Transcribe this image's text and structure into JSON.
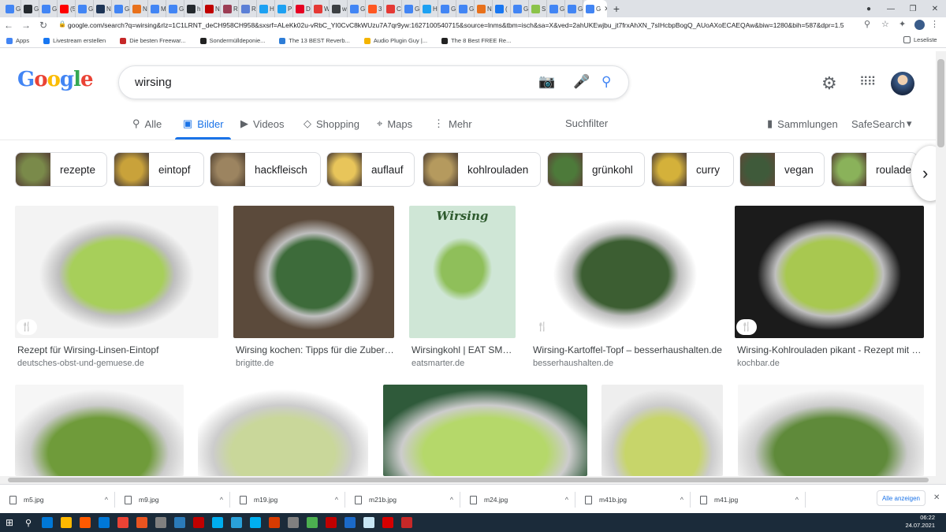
{
  "browser": {
    "tabs": [
      {
        "label": "G",
        "color": "#4285f4"
      },
      {
        "label": "G",
        "color": "#24292e"
      },
      {
        "label": "G",
        "color": "#4285f4"
      },
      {
        "label": "(5",
        "color": "#ff0000"
      },
      {
        "label": "G",
        "color": "#4285f4"
      },
      {
        "label": "N",
        "color": "#1d3557"
      },
      {
        "label": "G",
        "color": "#4285f4"
      },
      {
        "label": "N",
        "color": "#e8711c"
      },
      {
        "label": "M",
        "color": "#4285f4"
      },
      {
        "label": "G",
        "color": "#4285f4"
      },
      {
        "label": "h",
        "color": "#24292e"
      },
      {
        "label": "N",
        "color": "#c00000"
      },
      {
        "label": "R",
        "color": "#9c3d54"
      },
      {
        "label": "R",
        "color": "#5b7fd6"
      },
      {
        "label": "H",
        "color": "#1da1f2"
      },
      {
        "label": "P",
        "color": "#1da1f2"
      },
      {
        "label": "D",
        "color": "#e60023"
      },
      {
        "label": "W",
        "color": "#e53935"
      },
      {
        "label": "w",
        "color": "#3c4043"
      },
      {
        "label": "G",
        "color": "#4285f4"
      },
      {
        "label": "3",
        "color": "#ff5722"
      },
      {
        "label": "C",
        "color": "#e53935"
      },
      {
        "label": "G",
        "color": "#4285f4"
      },
      {
        "label": "H",
        "color": "#1da1f2"
      },
      {
        "label": "G",
        "color": "#4285f4"
      },
      {
        "label": "G",
        "color": "#4285f4"
      },
      {
        "label": "N",
        "color": "#e8711c"
      },
      {
        "label": "(",
        "color": "#1877f2"
      },
      {
        "label": "G",
        "color": "#4285f4"
      },
      {
        "label": "S",
        "color": "#8bc34a"
      },
      {
        "label": "G",
        "color": "#4285f4"
      },
      {
        "label": "G",
        "color": "#4285f4"
      },
      {
        "label": "G",
        "color": "#4285f4"
      }
    ],
    "active_tab_label": "G",
    "new_tab": "+",
    "url": "google.com/search?q=wirsing&rlz=1C1LRNT_deCH958CH958&sxsrf=ALeKk02u-vRbC_YI0CvC8kWUzu7A7qr9yw:1627100540715&source=lnms&tbm=isch&sa=X&ved=2ahUKEwjbu_jt7frxAhXN_7sIHcbpBogQ_AUoAXoECAEQAw&biw=1280&bih=587&dpr=1.5",
    "bookmarks": [
      {
        "label": "Apps",
        "color": "#4285f4"
      },
      {
        "label": "Livestream erstellen",
        "color": "#1877f2"
      },
      {
        "label": "Die besten Freewar...",
        "color": "#c62828"
      },
      {
        "label": "Sondermülldeponie...",
        "color": "#222222"
      },
      {
        "label": "The 13 BEST Reverb...",
        "color": "#2e7dd7"
      },
      {
        "label": "Audio Plugin Guy |...",
        "color": "#f4b400"
      },
      {
        "label": "The 8 Best FREE Re...",
        "color": "#222222"
      }
    ],
    "reading_list": "Leseliste"
  },
  "google": {
    "logo_letters": [
      {
        "char": "G",
        "color": "#4285f4"
      },
      {
        "char": "o",
        "color": "#ea4335"
      },
      {
        "char": "o",
        "color": "#fbbc05"
      },
      {
        "char": "g",
        "color": "#4285f4"
      },
      {
        "char": "l",
        "color": "#34a853"
      },
      {
        "char": "e",
        "color": "#ea4335"
      }
    ],
    "query": "wirsing",
    "nav": {
      "all": "Alle",
      "images": "Bilder",
      "videos": "Videos",
      "shopping": "Shopping",
      "maps": "Maps",
      "more": "Mehr",
      "filter": "Suchfilter",
      "collections": "Sammlungen",
      "safesearch": "SafeSearch"
    },
    "chips": [
      {
        "label": "rezepte",
        "color": "#7a8a4a"
      },
      {
        "label": "eintopf",
        "color": "#c9a23a"
      },
      {
        "label": "hackfleisch",
        "color": "#9c8460"
      },
      {
        "label": "auflauf",
        "color": "#e8c55a"
      },
      {
        "label": "kohlrouladen",
        "color": "#b59a5e"
      },
      {
        "label": "grünkohl",
        "color": "#4d7a3a"
      },
      {
        "label": "curry",
        "color": "#d4b13a"
      },
      {
        "label": "vegan",
        "color": "#3f5a3a"
      },
      {
        "label": "roulade",
        "color": "#8ab25a"
      }
    ],
    "results_row1": [
      {
        "title": "Rezept für Wirsing-Linsen-Eintopf",
        "source": "deutsches-obst-und-gemuese.de",
        "recipe": true,
        "bg": "#f3f3f3",
        "leaf": "#a7cf5a"
      },
      {
        "title": "Wirsing kochen: Tipps für die Zubereitung",
        "source": "brigitte.de",
        "recipe": false,
        "bg": "#5b4a3b",
        "leaf": "#3d6b3a"
      },
      {
        "title": "Wirsingkohl | EAT SMARTER",
        "source": "eatsmarter.de",
        "recipe": false,
        "bg": "#cfe6d6",
        "leaf": "#8fbf5a",
        "infographic": "Wirsing"
      },
      {
        "title": "Wirsing-Kartoffel-Topf – besserhaushalten.de",
        "source": "besserhaushalten.de",
        "recipe": true,
        "bg": "#ffffff",
        "leaf": "#3c5e32"
      },
      {
        "title": "Wirsing-Kohlrouladen pikant - Rezept mit Bild",
        "source": "kochbar.de",
        "recipe": true,
        "bg": "#1b1b1b",
        "leaf": "#a8c850"
      }
    ],
    "results_row2": [
      {
        "bg": "#f6f6f6",
        "leaf": "#6f9b3a"
      },
      {
        "bg": "#ffffff",
        "leaf": "#c9d79a"
      },
      {
        "bg": "#2f5a3a",
        "leaf": "#b5d86a"
      },
      {
        "bg": "#eeeeee",
        "leaf": "#c7d56a"
      },
      {
        "bg": "#f7f7f7",
        "leaf": "#5f8a3a"
      }
    ]
  },
  "downloads": {
    "files": [
      "m5.jpg",
      "m9.jpg",
      "m19.jpg",
      "m21b.jpg",
      "m24.jpg",
      "m41b.jpg",
      "m41.jpg"
    ],
    "show_all": "Alle anzeigen"
  },
  "taskbar": {
    "apps": [
      "#0078d7",
      "#ffb900",
      "#ff5a00",
      "#0078d7",
      "#ea4335",
      "#e95420",
      "#808080",
      "#2b7bb9",
      "#c00000",
      "#00adef",
      "#2aa1da",
      "#00aff0",
      "#d83b01",
      "#808080",
      "#4caf50",
      "#c00000",
      "#1b6ac9",
      "#c8e6f5",
      "#d50000",
      "#c62828"
    ],
    "time": "06:22",
    "date": "24.07.2021"
  }
}
